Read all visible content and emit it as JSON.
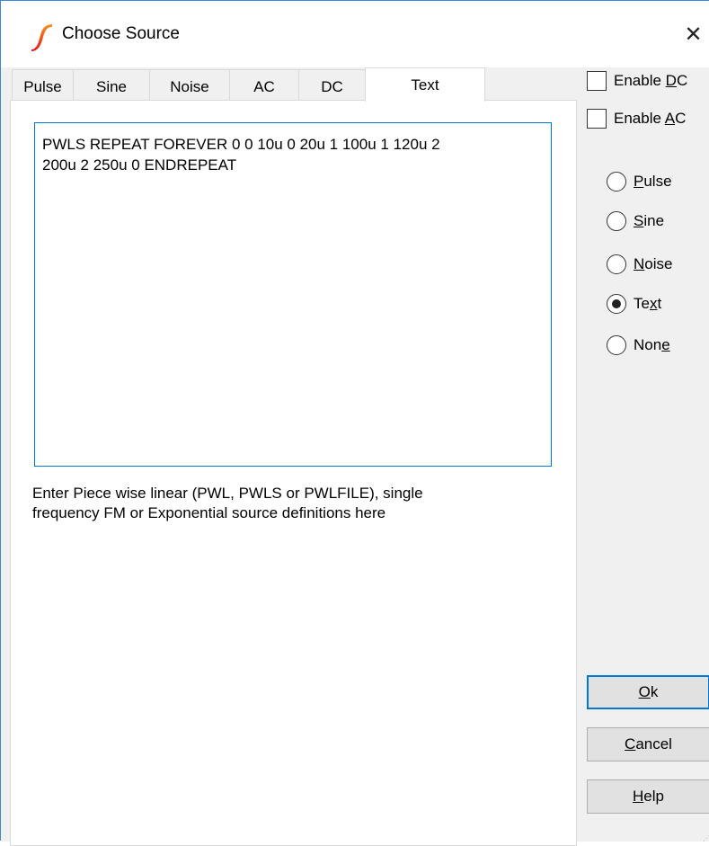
{
  "window": {
    "title": "Choose Source",
    "close_glyph": "✕"
  },
  "tabs": [
    {
      "label": "Pulse",
      "active": false
    },
    {
      "label": "Sine",
      "active": false
    },
    {
      "label": "Noise",
      "active": false
    },
    {
      "label": "AC",
      "active": false
    },
    {
      "label": "DC",
      "active": false
    },
    {
      "label": "Text",
      "active": true
    }
  ],
  "editor": {
    "value": "PWLS REPEAT FOREVER 0 0 10u 0 20u 1 100u 1 120u 2\n200u 2 250u 0 ENDREPEAT"
  },
  "hint": {
    "line1": "Enter Piece wise linear (PWL, PWLS or PWLFILE), single",
    "line2": "frequency FM or Exponential source definitions here"
  },
  "checkboxes": {
    "enable_dc": {
      "pre": "Enable ",
      "accel": "D",
      "post": "C",
      "checked": false
    },
    "enable_ac": {
      "pre": "Enable ",
      "accel": "A",
      "post": "C",
      "checked": false
    }
  },
  "radios": {
    "pulse": {
      "pre": "",
      "accel": "P",
      "post": "ulse",
      "checked": false
    },
    "sine": {
      "pre": "",
      "accel": "S",
      "post": "ine",
      "checked": false
    },
    "noise": {
      "pre": "",
      "accel": "N",
      "post": "oise",
      "checked": false
    },
    "text": {
      "pre": "Te",
      "accel": "x",
      "post": "t",
      "checked": true
    },
    "none": {
      "pre": "Non",
      "accel": "e",
      "post": "",
      "checked": false
    }
  },
  "buttons": {
    "ok": {
      "pre": "",
      "accel": "O",
      "post": "k"
    },
    "cancel": {
      "pre": "",
      "accel": "C",
      "post": "ancel"
    },
    "help": {
      "pre": "",
      "accel": "H",
      "post": "elp"
    }
  },
  "icons": {
    "app": "ltspice-source-icon",
    "close": "close-icon"
  },
  "colors": {
    "accent": "#0078d7",
    "icon_red": "#e8121b",
    "icon_orange": "#f7941d"
  }
}
